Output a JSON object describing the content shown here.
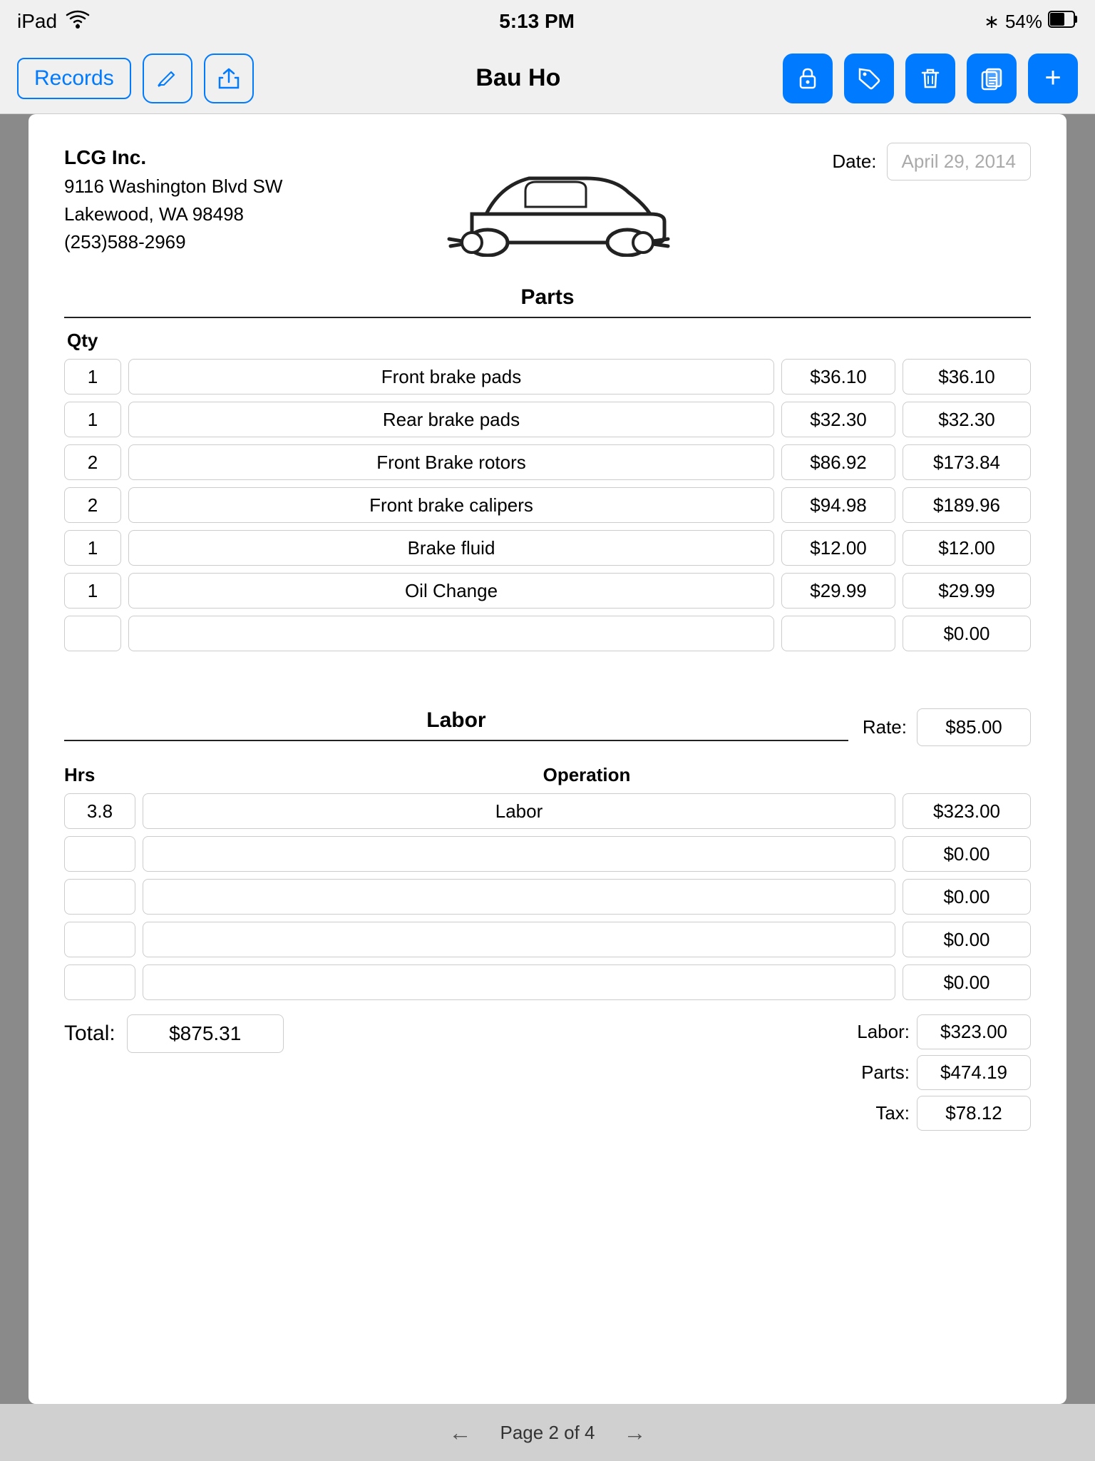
{
  "status_bar": {
    "left": "iPad",
    "wifi_icon": "wifi",
    "time": "5:13 PM",
    "bluetooth_icon": "bluetooth",
    "battery": "54%"
  },
  "nav_bar": {
    "records_label": "Records",
    "title": "Bau Ho",
    "icons": {
      "edit": "pencil",
      "share": "share",
      "lock": "lock",
      "tag": "tag",
      "trash": "trash",
      "copy": "copy",
      "add": "+"
    }
  },
  "document": {
    "company": {
      "name": "LCG Inc.",
      "address1": "9116 Washington Blvd SW",
      "address2": "Lakewood, WA  98498",
      "phone": "(253)588-2969"
    },
    "date_label": "Date:",
    "date_value": "April 29, 2014",
    "parts_section": {
      "title": "Parts",
      "qty_label": "Qty",
      "rows": [
        {
          "qty": "1",
          "desc": "Front brake pads",
          "price": "$36.10",
          "total": "$36.10"
        },
        {
          "qty": "1",
          "desc": "Rear brake pads",
          "price": "$32.30",
          "total": "$32.30"
        },
        {
          "qty": "2",
          "desc": "Front Brake rotors",
          "price": "$86.92",
          "total": "$173.84"
        },
        {
          "qty": "2",
          "desc": "Front brake calipers",
          "price": "$94.98",
          "total": "$189.96"
        },
        {
          "qty": "1",
          "desc": "Brake fluid",
          "price": "$12.00",
          "total": "$12.00"
        },
        {
          "qty": "1",
          "desc": "Oil Change",
          "price": "$29.99",
          "total": "$29.99"
        },
        {
          "qty": "",
          "desc": "",
          "price": "",
          "total": "$0.00"
        }
      ]
    },
    "labor_section": {
      "title": "Labor",
      "rate_label": "Rate:",
      "rate_value": "$85.00",
      "hrs_label": "Hrs",
      "operation_label": "Operation",
      "rows": [
        {
          "hrs": "3.8",
          "operation": "Labor",
          "amount": "$323.00"
        },
        {
          "hrs": "",
          "operation": "",
          "amount": "$0.00"
        },
        {
          "hrs": "",
          "operation": "",
          "amount": "$0.00"
        },
        {
          "hrs": "",
          "operation": "",
          "amount": "$0.00"
        },
        {
          "hrs": "",
          "operation": "",
          "amount": "$0.00"
        }
      ]
    },
    "summary": {
      "total_label": "Total:",
      "total_value": "$875.31",
      "labor_label": "Labor:",
      "labor_value": "$323.00",
      "parts_label": "Parts:",
      "parts_value": "$474.19",
      "tax_label": "Tax:",
      "tax_value": "$78.12"
    }
  },
  "pagination": {
    "text": "Page 2 of 4",
    "prev_arrow": "←",
    "next_arrow": "→"
  }
}
